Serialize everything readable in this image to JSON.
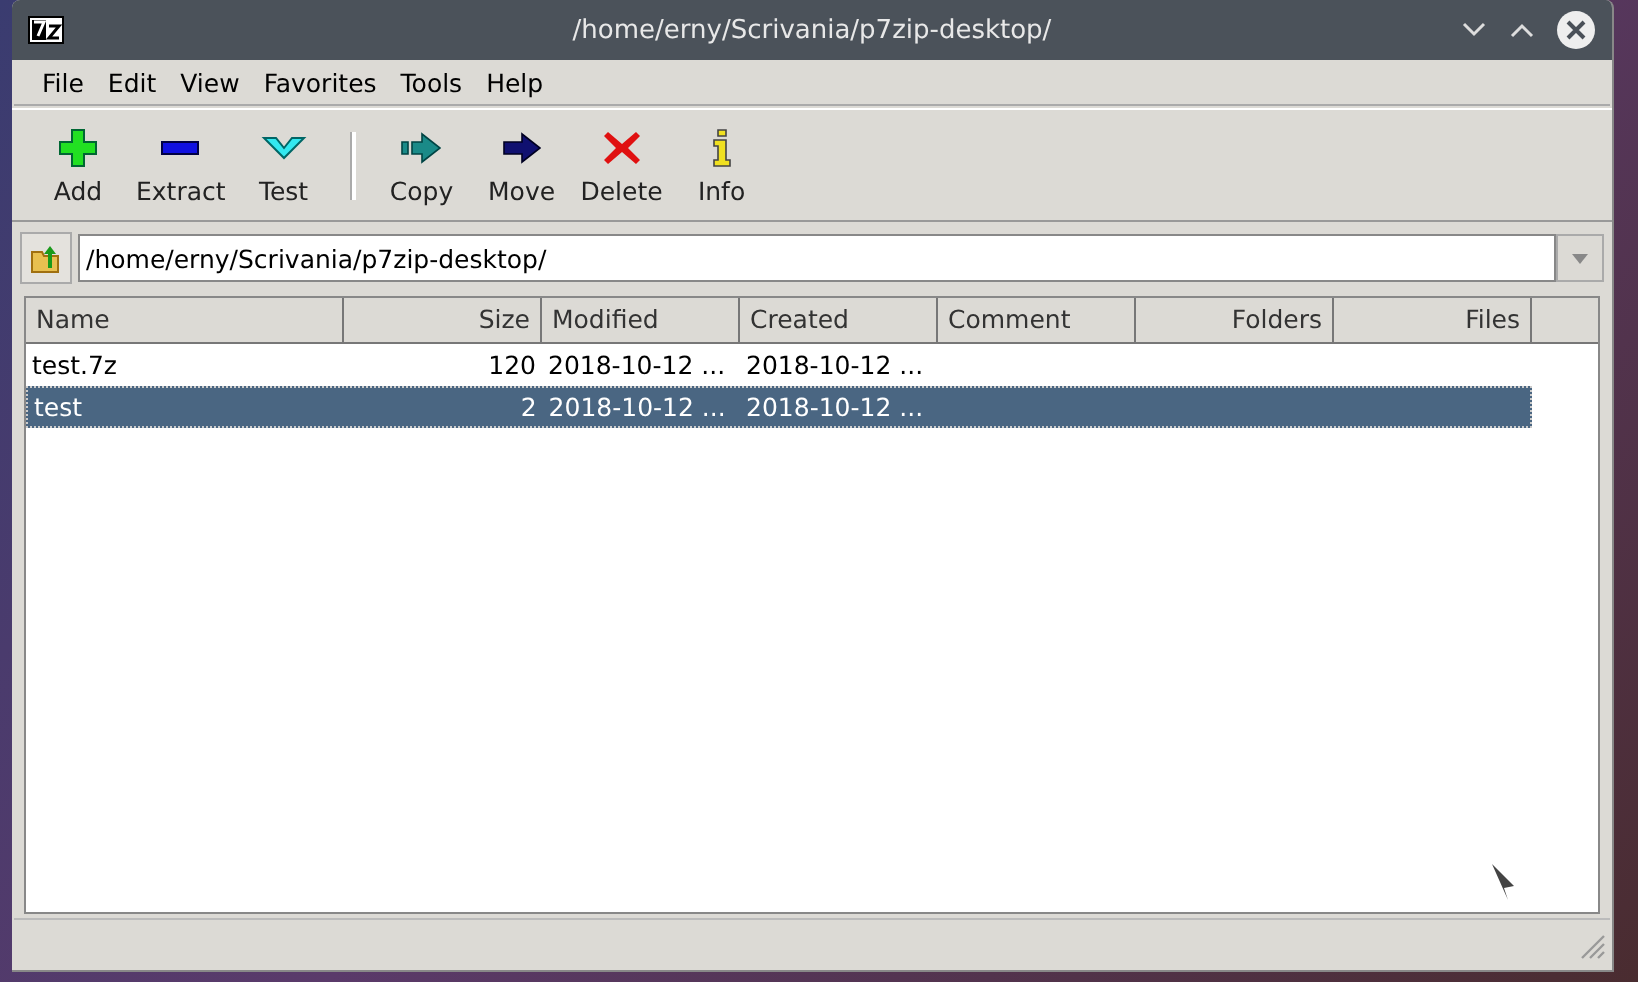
{
  "window": {
    "title": "/home/erny/Scrivania/p7zip-desktop/"
  },
  "menu": [
    "File",
    "Edit",
    "View",
    "Favorites",
    "Tools",
    "Help"
  ],
  "toolbar": [
    {
      "kind": "add",
      "label": "Add"
    },
    {
      "kind": "extract",
      "label": "Extract"
    },
    {
      "kind": "test",
      "label": "Test"
    },
    {
      "kind": "separator"
    },
    {
      "kind": "copy",
      "label": "Copy"
    },
    {
      "kind": "move",
      "label": "Move"
    },
    {
      "kind": "delete",
      "label": "Delete"
    },
    {
      "kind": "info",
      "label": "Info"
    }
  ],
  "address": {
    "value": "/home/erny/Scrivania/p7zip-desktop/"
  },
  "table": {
    "columns": [
      "Name",
      "Size",
      "Modified",
      "Created",
      "Comment",
      "Folders",
      "Files"
    ],
    "rows": [
      {
        "cells": [
          "test.7z",
          "120",
          "2018-10-12 ...",
          "2018-10-12 ...",
          "",
          "",
          ""
        ],
        "selected": false
      },
      {
        "cells": [
          "test",
          "2",
          "2018-10-12 ...",
          "2018-10-12 ...",
          "",
          "",
          ""
        ],
        "selected": true
      }
    ]
  }
}
